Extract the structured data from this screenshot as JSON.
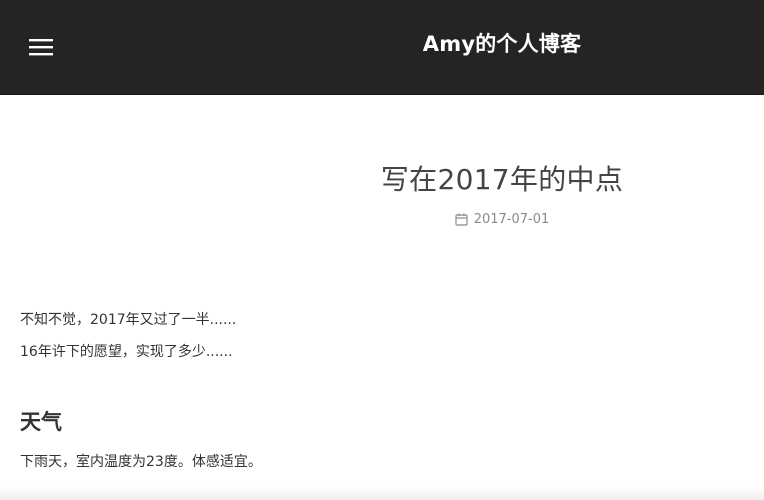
{
  "header": {
    "menu_icon": "hamburger-menu-icon",
    "site_title": "Amy的个人博客",
    "background_color": "#242424"
  },
  "post": {
    "title": "写在2017年的中点",
    "date_icon": "calendar-icon",
    "date": "2017-07-01",
    "intro_lines": [
      "不知不觉，2017年又过了一半......",
      "16年许下的愿望，实现了多少......"
    ],
    "sections": [
      {
        "heading": "天气",
        "text": "下雨天，室内温度为23度。体感适宜。"
      }
    ]
  }
}
